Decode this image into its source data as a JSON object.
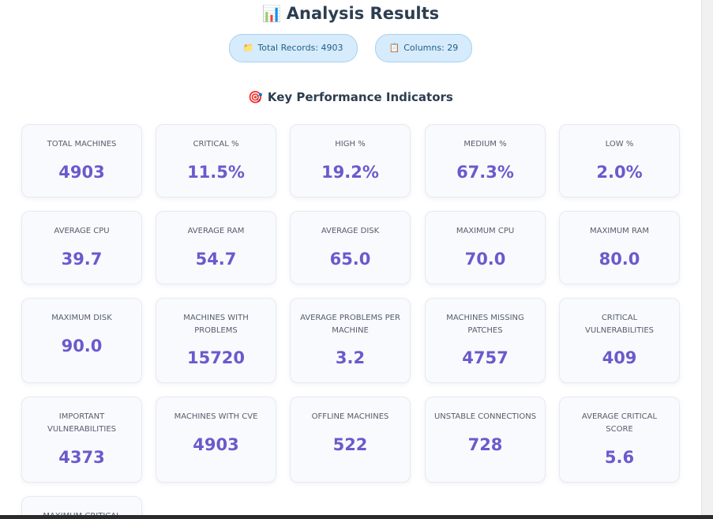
{
  "header": {
    "icon": "bar-chart-icon",
    "title_icon_glyph": "📊",
    "title": "Analysis Results"
  },
  "badges": {
    "records": {
      "icon": "folder-icon",
      "glyph": "📁",
      "label": "Total Records: 4903"
    },
    "columns": {
      "icon": "clipboard-icon",
      "glyph": "📋",
      "label": "Columns: 29"
    }
  },
  "kpi_section": {
    "icon": "target-icon",
    "glyph": "🎯",
    "heading": "Key Performance Indicators"
  },
  "accent_color": "#6a5acd",
  "kpis": [
    {
      "label": "TOTAL MACHINES",
      "value": "4903"
    },
    {
      "label": "CRITICAL %",
      "value": "11.5%"
    },
    {
      "label": "HIGH %",
      "value": "19.2%"
    },
    {
      "label": "MEDIUM %",
      "value": "67.3%"
    },
    {
      "label": "LOW %",
      "value": "2.0%"
    },
    {
      "label": "AVERAGE CPU",
      "value": "39.7"
    },
    {
      "label": "AVERAGE RAM",
      "value": "54.7"
    },
    {
      "label": "AVERAGE DISK",
      "value": "65.0"
    },
    {
      "label": "MAXIMUM CPU",
      "value": "70.0"
    },
    {
      "label": "MAXIMUM RAM",
      "value": "80.0"
    },
    {
      "label": "MAXIMUM DISK",
      "value": "90.0"
    },
    {
      "label": "MACHINES WITH PROBLEMS",
      "value": "15720"
    },
    {
      "label": "AVERAGE PROBLEMS PER MACHINE",
      "value": "3.2"
    },
    {
      "label": "MACHINES MISSING PATCHES",
      "value": "4757"
    },
    {
      "label": "CRITICAL VULNERABILITIES",
      "value": "409"
    },
    {
      "label": "IMPORTANT VULNERABILITIES",
      "value": "4373"
    },
    {
      "label": "MACHINES WITH CVE",
      "value": "4903"
    },
    {
      "label": "OFFLINE MACHINES",
      "value": "522"
    },
    {
      "label": "UNSTABLE CONNECTIONS",
      "value": "728"
    },
    {
      "label": "AVERAGE CRITICAL SCORE",
      "value": "5.6"
    },
    {
      "label": "MAXIMUM CRITICAL",
      "value": ""
    }
  ]
}
